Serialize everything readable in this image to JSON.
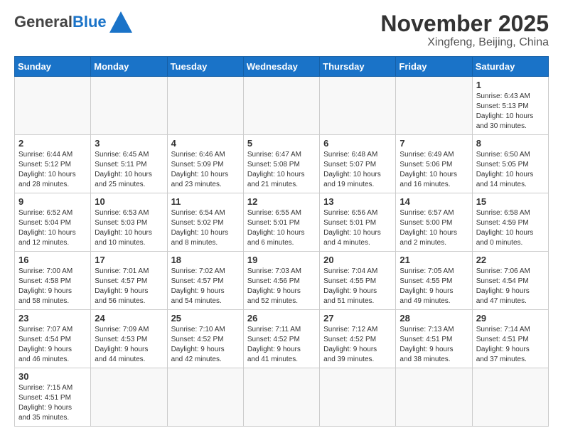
{
  "header": {
    "logo_general": "General",
    "logo_blue": "Blue",
    "title": "November 2025",
    "subtitle": "Xingfeng, Beijing, China"
  },
  "weekdays": [
    "Sunday",
    "Monday",
    "Tuesday",
    "Wednesday",
    "Thursday",
    "Friday",
    "Saturday"
  ],
  "weeks": [
    [
      {
        "day": "",
        "info": "",
        "empty": true
      },
      {
        "day": "",
        "info": "",
        "empty": true
      },
      {
        "day": "",
        "info": "",
        "empty": true
      },
      {
        "day": "",
        "info": "",
        "empty": true
      },
      {
        "day": "",
        "info": "",
        "empty": true
      },
      {
        "day": "",
        "info": "",
        "empty": true
      },
      {
        "day": "1",
        "info": "Sunrise: 6:43 AM\nSunset: 5:13 PM\nDaylight: 10 hours\nand 30 minutes.",
        "empty": false
      }
    ],
    [
      {
        "day": "2",
        "info": "Sunrise: 6:44 AM\nSunset: 5:12 PM\nDaylight: 10 hours\nand 28 minutes.",
        "empty": false
      },
      {
        "day": "3",
        "info": "Sunrise: 6:45 AM\nSunset: 5:11 PM\nDaylight: 10 hours\nand 25 minutes.",
        "empty": false
      },
      {
        "day": "4",
        "info": "Sunrise: 6:46 AM\nSunset: 5:09 PM\nDaylight: 10 hours\nand 23 minutes.",
        "empty": false
      },
      {
        "day": "5",
        "info": "Sunrise: 6:47 AM\nSunset: 5:08 PM\nDaylight: 10 hours\nand 21 minutes.",
        "empty": false
      },
      {
        "day": "6",
        "info": "Sunrise: 6:48 AM\nSunset: 5:07 PM\nDaylight: 10 hours\nand 19 minutes.",
        "empty": false
      },
      {
        "day": "7",
        "info": "Sunrise: 6:49 AM\nSunset: 5:06 PM\nDaylight: 10 hours\nand 16 minutes.",
        "empty": false
      },
      {
        "day": "8",
        "info": "Sunrise: 6:50 AM\nSunset: 5:05 PM\nDaylight: 10 hours\nand 14 minutes.",
        "empty": false
      }
    ],
    [
      {
        "day": "9",
        "info": "Sunrise: 6:52 AM\nSunset: 5:04 PM\nDaylight: 10 hours\nand 12 minutes.",
        "empty": false
      },
      {
        "day": "10",
        "info": "Sunrise: 6:53 AM\nSunset: 5:03 PM\nDaylight: 10 hours\nand 10 minutes.",
        "empty": false
      },
      {
        "day": "11",
        "info": "Sunrise: 6:54 AM\nSunset: 5:02 PM\nDaylight: 10 hours\nand 8 minutes.",
        "empty": false
      },
      {
        "day": "12",
        "info": "Sunrise: 6:55 AM\nSunset: 5:01 PM\nDaylight: 10 hours\nand 6 minutes.",
        "empty": false
      },
      {
        "day": "13",
        "info": "Sunrise: 6:56 AM\nSunset: 5:01 PM\nDaylight: 10 hours\nand 4 minutes.",
        "empty": false
      },
      {
        "day": "14",
        "info": "Sunrise: 6:57 AM\nSunset: 5:00 PM\nDaylight: 10 hours\nand 2 minutes.",
        "empty": false
      },
      {
        "day": "15",
        "info": "Sunrise: 6:58 AM\nSunset: 4:59 PM\nDaylight: 10 hours\nand 0 minutes.",
        "empty": false
      }
    ],
    [
      {
        "day": "16",
        "info": "Sunrise: 7:00 AM\nSunset: 4:58 PM\nDaylight: 9 hours\nand 58 minutes.",
        "empty": false
      },
      {
        "day": "17",
        "info": "Sunrise: 7:01 AM\nSunset: 4:57 PM\nDaylight: 9 hours\nand 56 minutes.",
        "empty": false
      },
      {
        "day": "18",
        "info": "Sunrise: 7:02 AM\nSunset: 4:57 PM\nDaylight: 9 hours\nand 54 minutes.",
        "empty": false
      },
      {
        "day": "19",
        "info": "Sunrise: 7:03 AM\nSunset: 4:56 PM\nDaylight: 9 hours\nand 52 minutes.",
        "empty": false
      },
      {
        "day": "20",
        "info": "Sunrise: 7:04 AM\nSunset: 4:55 PM\nDaylight: 9 hours\nand 51 minutes.",
        "empty": false
      },
      {
        "day": "21",
        "info": "Sunrise: 7:05 AM\nSunset: 4:55 PM\nDaylight: 9 hours\nand 49 minutes.",
        "empty": false
      },
      {
        "day": "22",
        "info": "Sunrise: 7:06 AM\nSunset: 4:54 PM\nDaylight: 9 hours\nand 47 minutes.",
        "empty": false
      }
    ],
    [
      {
        "day": "23",
        "info": "Sunrise: 7:07 AM\nSunset: 4:54 PM\nDaylight: 9 hours\nand 46 minutes.",
        "empty": false
      },
      {
        "day": "24",
        "info": "Sunrise: 7:09 AM\nSunset: 4:53 PM\nDaylight: 9 hours\nand 44 minutes.",
        "empty": false
      },
      {
        "day": "25",
        "info": "Sunrise: 7:10 AM\nSunset: 4:52 PM\nDaylight: 9 hours\nand 42 minutes.",
        "empty": false
      },
      {
        "day": "26",
        "info": "Sunrise: 7:11 AM\nSunset: 4:52 PM\nDaylight: 9 hours\nand 41 minutes.",
        "empty": false
      },
      {
        "day": "27",
        "info": "Sunrise: 7:12 AM\nSunset: 4:52 PM\nDaylight: 9 hours\nand 39 minutes.",
        "empty": false
      },
      {
        "day": "28",
        "info": "Sunrise: 7:13 AM\nSunset: 4:51 PM\nDaylight: 9 hours\nand 38 minutes.",
        "empty": false
      },
      {
        "day": "29",
        "info": "Sunrise: 7:14 AM\nSunset: 4:51 PM\nDaylight: 9 hours\nand 37 minutes.",
        "empty": false
      }
    ],
    [
      {
        "day": "30",
        "info": "Sunrise: 7:15 AM\nSunset: 4:51 PM\nDaylight: 9 hours\nand 35 minutes.",
        "empty": false
      },
      {
        "day": "",
        "info": "",
        "empty": true
      },
      {
        "day": "",
        "info": "",
        "empty": true
      },
      {
        "day": "",
        "info": "",
        "empty": true
      },
      {
        "day": "",
        "info": "",
        "empty": true
      },
      {
        "day": "",
        "info": "",
        "empty": true
      },
      {
        "day": "",
        "info": "",
        "empty": true
      }
    ]
  ]
}
